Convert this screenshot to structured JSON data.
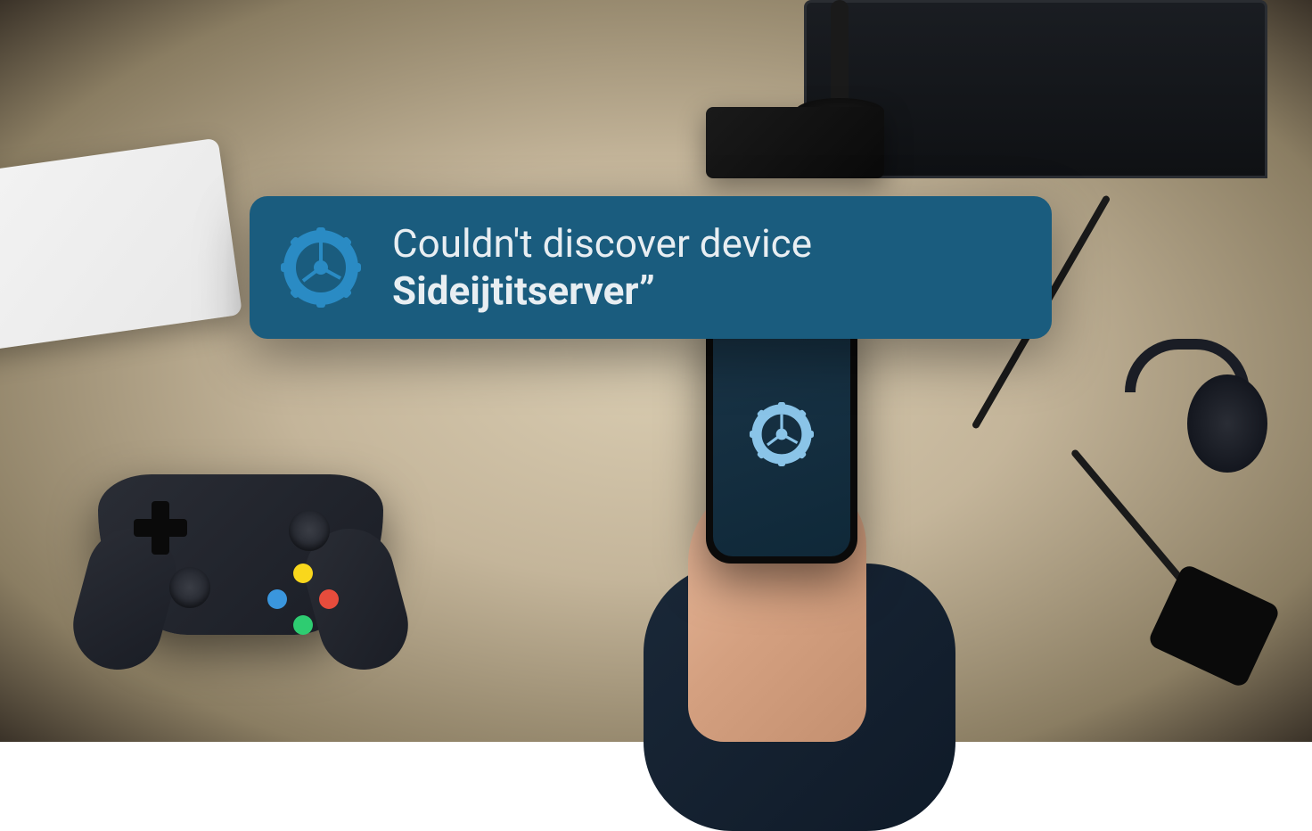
{
  "banner": {
    "line1": "Couldn't discover device",
    "line2": "Sideijtitserver",
    "quote": "”",
    "icon_name": "gear-icon",
    "background_color": "#1a5c7e",
    "text_color": "#e8eef2",
    "icon_color": "#2a8bc4"
  },
  "phone": {
    "icon_name": "gear-icon",
    "screen_color": "#1a3548"
  }
}
